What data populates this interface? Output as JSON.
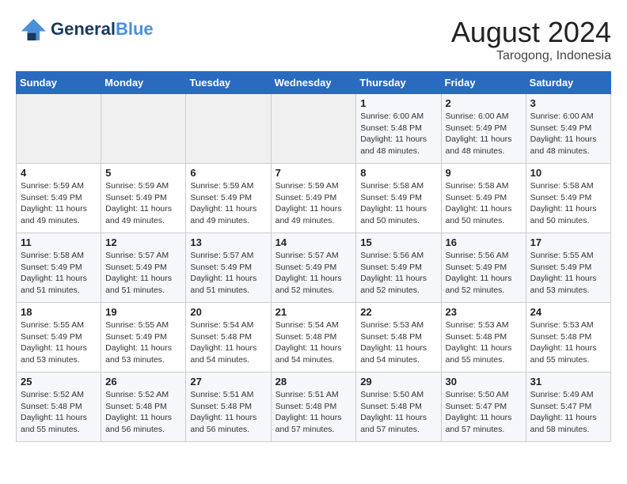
{
  "header": {
    "logo_line1": "General",
    "logo_line2": "Blue",
    "month_year": "August 2024",
    "location": "Tarogong, Indonesia"
  },
  "weekdays": [
    "Sunday",
    "Monday",
    "Tuesday",
    "Wednesday",
    "Thursday",
    "Friday",
    "Saturday"
  ],
  "weeks": [
    [
      {
        "day": "",
        "sunrise": "",
        "sunset": "",
        "daylight": ""
      },
      {
        "day": "",
        "sunrise": "",
        "sunset": "",
        "daylight": ""
      },
      {
        "day": "",
        "sunrise": "",
        "sunset": "",
        "daylight": ""
      },
      {
        "day": "",
        "sunrise": "",
        "sunset": "",
        "daylight": ""
      },
      {
        "day": "1",
        "sunrise": "Sunrise: 6:00 AM",
        "sunset": "Sunset: 5:48 PM",
        "daylight": "Daylight: 11 hours and 48 minutes."
      },
      {
        "day": "2",
        "sunrise": "Sunrise: 6:00 AM",
        "sunset": "Sunset: 5:49 PM",
        "daylight": "Daylight: 11 hours and 48 minutes."
      },
      {
        "day": "3",
        "sunrise": "Sunrise: 6:00 AM",
        "sunset": "Sunset: 5:49 PM",
        "daylight": "Daylight: 11 hours and 48 minutes."
      }
    ],
    [
      {
        "day": "4",
        "sunrise": "Sunrise: 5:59 AM",
        "sunset": "Sunset: 5:49 PM",
        "daylight": "Daylight: 11 hours and 49 minutes."
      },
      {
        "day": "5",
        "sunrise": "Sunrise: 5:59 AM",
        "sunset": "Sunset: 5:49 PM",
        "daylight": "Daylight: 11 hours and 49 minutes."
      },
      {
        "day": "6",
        "sunrise": "Sunrise: 5:59 AM",
        "sunset": "Sunset: 5:49 PM",
        "daylight": "Daylight: 11 hours and 49 minutes."
      },
      {
        "day": "7",
        "sunrise": "Sunrise: 5:59 AM",
        "sunset": "Sunset: 5:49 PM",
        "daylight": "Daylight: 11 hours and 49 minutes."
      },
      {
        "day": "8",
        "sunrise": "Sunrise: 5:58 AM",
        "sunset": "Sunset: 5:49 PM",
        "daylight": "Daylight: 11 hours and 50 minutes."
      },
      {
        "day": "9",
        "sunrise": "Sunrise: 5:58 AM",
        "sunset": "Sunset: 5:49 PM",
        "daylight": "Daylight: 11 hours and 50 minutes."
      },
      {
        "day": "10",
        "sunrise": "Sunrise: 5:58 AM",
        "sunset": "Sunset: 5:49 PM",
        "daylight": "Daylight: 11 hours and 50 minutes."
      }
    ],
    [
      {
        "day": "11",
        "sunrise": "Sunrise: 5:58 AM",
        "sunset": "Sunset: 5:49 PM",
        "daylight": "Daylight: 11 hours and 51 minutes."
      },
      {
        "day": "12",
        "sunrise": "Sunrise: 5:57 AM",
        "sunset": "Sunset: 5:49 PM",
        "daylight": "Daylight: 11 hours and 51 minutes."
      },
      {
        "day": "13",
        "sunrise": "Sunrise: 5:57 AM",
        "sunset": "Sunset: 5:49 PM",
        "daylight": "Daylight: 11 hours and 51 minutes."
      },
      {
        "day": "14",
        "sunrise": "Sunrise: 5:57 AM",
        "sunset": "Sunset: 5:49 PM",
        "daylight": "Daylight: 11 hours and 52 minutes."
      },
      {
        "day": "15",
        "sunrise": "Sunrise: 5:56 AM",
        "sunset": "Sunset: 5:49 PM",
        "daylight": "Daylight: 11 hours and 52 minutes."
      },
      {
        "day": "16",
        "sunrise": "Sunrise: 5:56 AM",
        "sunset": "Sunset: 5:49 PM",
        "daylight": "Daylight: 11 hours and 52 minutes."
      },
      {
        "day": "17",
        "sunrise": "Sunrise: 5:55 AM",
        "sunset": "Sunset: 5:49 PM",
        "daylight": "Daylight: 11 hours and 53 minutes."
      }
    ],
    [
      {
        "day": "18",
        "sunrise": "Sunrise: 5:55 AM",
        "sunset": "Sunset: 5:49 PM",
        "daylight": "Daylight: 11 hours and 53 minutes."
      },
      {
        "day": "19",
        "sunrise": "Sunrise: 5:55 AM",
        "sunset": "Sunset: 5:49 PM",
        "daylight": "Daylight: 11 hours and 53 minutes."
      },
      {
        "day": "20",
        "sunrise": "Sunrise: 5:54 AM",
        "sunset": "Sunset: 5:48 PM",
        "daylight": "Daylight: 11 hours and 54 minutes."
      },
      {
        "day": "21",
        "sunrise": "Sunrise: 5:54 AM",
        "sunset": "Sunset: 5:48 PM",
        "daylight": "Daylight: 11 hours and 54 minutes."
      },
      {
        "day": "22",
        "sunrise": "Sunrise: 5:53 AM",
        "sunset": "Sunset: 5:48 PM",
        "daylight": "Daylight: 11 hours and 54 minutes."
      },
      {
        "day": "23",
        "sunrise": "Sunrise: 5:53 AM",
        "sunset": "Sunset: 5:48 PM",
        "daylight": "Daylight: 11 hours and 55 minutes."
      },
      {
        "day": "24",
        "sunrise": "Sunrise: 5:53 AM",
        "sunset": "Sunset: 5:48 PM",
        "daylight": "Daylight: 11 hours and 55 minutes."
      }
    ],
    [
      {
        "day": "25",
        "sunrise": "Sunrise: 5:52 AM",
        "sunset": "Sunset: 5:48 PM",
        "daylight": "Daylight: 11 hours and 55 minutes."
      },
      {
        "day": "26",
        "sunrise": "Sunrise: 5:52 AM",
        "sunset": "Sunset: 5:48 PM",
        "daylight": "Daylight: 11 hours and 56 minutes."
      },
      {
        "day": "27",
        "sunrise": "Sunrise: 5:51 AM",
        "sunset": "Sunset: 5:48 PM",
        "daylight": "Daylight: 11 hours and 56 minutes."
      },
      {
        "day": "28",
        "sunrise": "Sunrise: 5:51 AM",
        "sunset": "Sunset: 5:48 PM",
        "daylight": "Daylight: 11 hours and 57 minutes."
      },
      {
        "day": "29",
        "sunrise": "Sunrise: 5:50 AM",
        "sunset": "Sunset: 5:48 PM",
        "daylight": "Daylight: 11 hours and 57 minutes."
      },
      {
        "day": "30",
        "sunrise": "Sunrise: 5:50 AM",
        "sunset": "Sunset: 5:47 PM",
        "daylight": "Daylight: 11 hours and 57 minutes."
      },
      {
        "day": "31",
        "sunrise": "Sunrise: 5:49 AM",
        "sunset": "Sunset: 5:47 PM",
        "daylight": "Daylight: 11 hours and 58 minutes."
      }
    ]
  ]
}
